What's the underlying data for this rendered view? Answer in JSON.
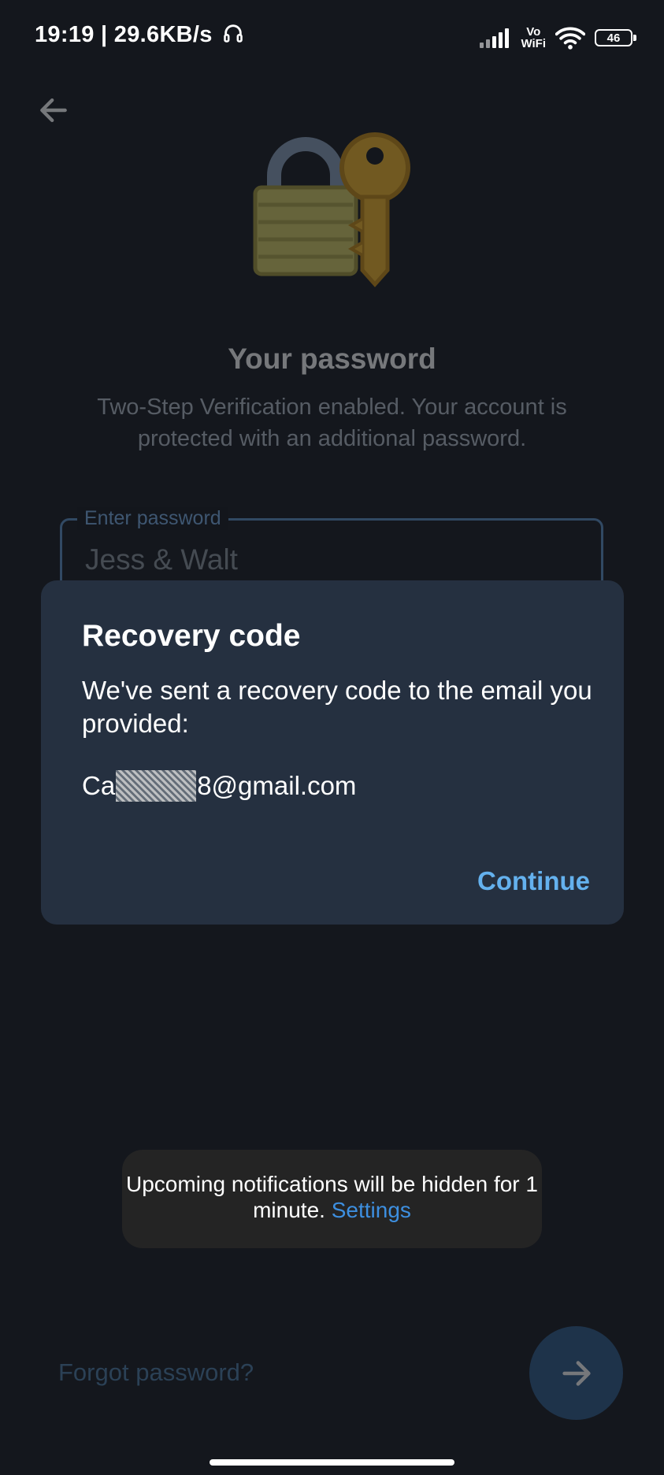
{
  "status_bar": {
    "time_speed": "19:19 | 29.6KB/s",
    "headphones_icon": "headphones-icon",
    "signal_icon": "signal-bars-icon",
    "vowifi_top": "Vo",
    "vowifi_bottom": "WiFi",
    "wifi_icon": "wifi-icon",
    "battery_level": "46"
  },
  "screen": {
    "back_icon": "arrow-left-icon",
    "illustration": "lock-and-key-icon",
    "title": "Your password",
    "subtitle": "Two-Step Verification enabled. Your account is protected with an additional password.",
    "password_label": "Enter password",
    "password_value": "Jess & Walt",
    "forgot_link": "Forgot password?",
    "next_icon": "arrow-right-icon"
  },
  "dialog": {
    "title": "Recovery code",
    "message": "We've sent a recovery code to the email you provided:",
    "email_prefix": "Ca",
    "email_suffix": "8@gmail.com",
    "continue_label": "Continue"
  },
  "toast": {
    "message": "Upcoming notifications will be hidden for 1 minute.",
    "link": "Settings"
  },
  "colors": {
    "background": "#14171d",
    "dialog": "#253040",
    "accent": "#64b1ee",
    "toast": "#242424"
  }
}
